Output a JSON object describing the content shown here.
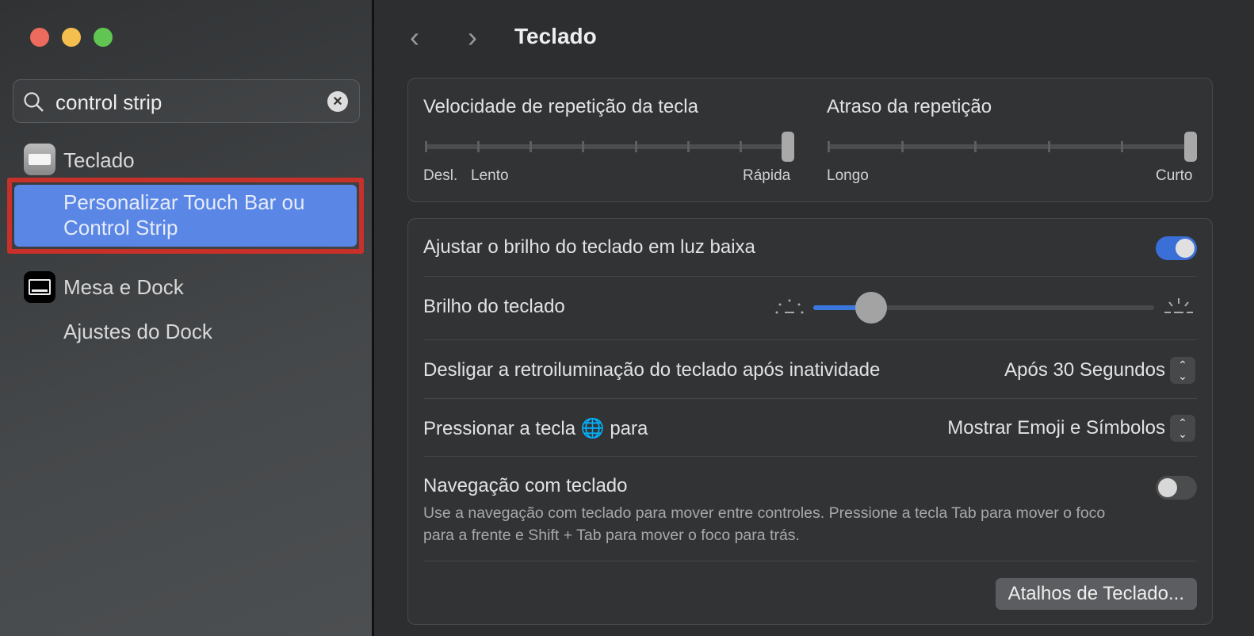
{
  "window": {
    "controls": {
      "close_color": "#ec6a5e",
      "minimize_color": "#f4bf4f",
      "zoom_color": "#61c554"
    }
  },
  "sidebar": {
    "search": {
      "value": "control strip",
      "clear_icon": "xmark-circle-icon"
    },
    "results": [
      {
        "label": "Teclado",
        "icon": "keyboard-icon"
      },
      {
        "label": "Personalizar Touch Bar ou Control Strip",
        "line1": "Personalizar Touch Bar ou",
        "line2": "Control Strip",
        "selected": true
      },
      {
        "label": "Mesa e Dock",
        "icon": "desktop-dock-icon"
      },
      {
        "label": "Ajustes do Dock"
      }
    ]
  },
  "header": {
    "title": "Teclado"
  },
  "repeat": {
    "speed": {
      "label": "Velocidade de repetição da tecla",
      "min_label": "Desl.",
      "second_label": "Lento",
      "max_label": "Rápida",
      "ticks": 8,
      "value_index": 7
    },
    "delay": {
      "label": "Atraso da repetição",
      "min_label": "Longo",
      "max_label": "Curto",
      "ticks": 6,
      "value_index": 5
    }
  },
  "settings": {
    "low_light": {
      "label": "Ajustar o brilho do teclado em luz baixa",
      "on": true
    },
    "brightness": {
      "label": "Brilho do teclado",
      "value_percent": 17
    },
    "backlight_off": {
      "label": "Desligar a retroiluminação do teclado após inatividade",
      "value": "Após 30 Segundos"
    },
    "globe_key": {
      "label_before": "Pressionar a tecla",
      "label_after": "para",
      "value": "Mostrar Emoji e Símbolos"
    },
    "keyboard_nav": {
      "label": "Navegação com teclado",
      "description": "Use a navegação com teclado para mover entre controles. Pressione a tecla Tab para mover o foco para a frente e Shift + Tab para mover o foco para trás.",
      "on": false
    },
    "shortcuts_button": "Atalhos de Teclado..."
  },
  "accent": "#3b6fd8"
}
